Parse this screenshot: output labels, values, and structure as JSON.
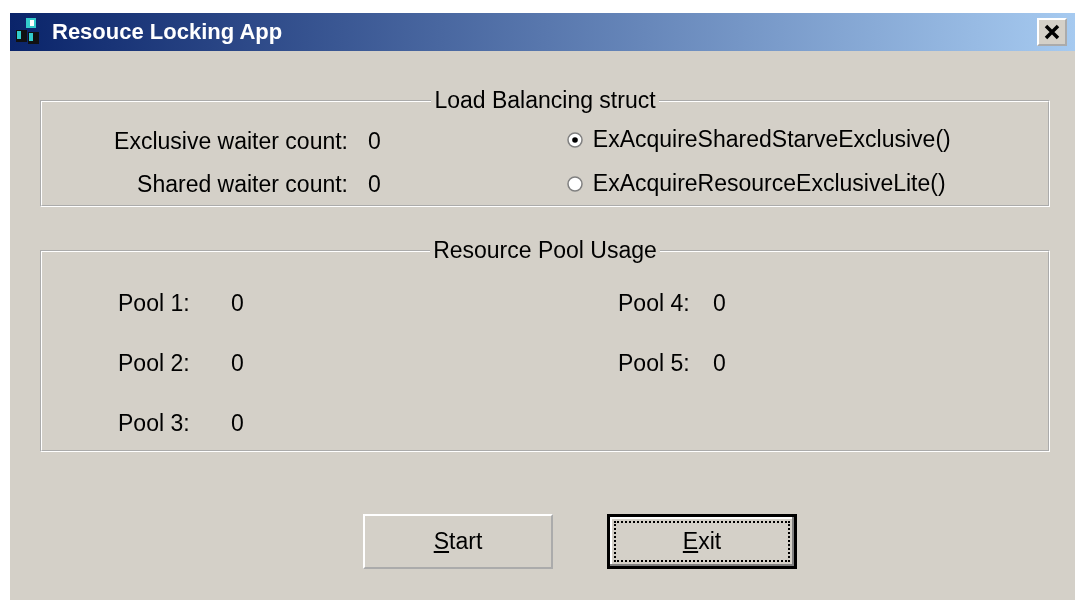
{
  "window": {
    "title": "Resouce Locking App"
  },
  "load_balancing": {
    "title": "Load Balancing struct",
    "counts": [
      {
        "label": "Exclusive waiter count:",
        "value": "0"
      },
      {
        "label": "Shared waiter count:",
        "value": "0"
      }
    ],
    "options": [
      {
        "label": "ExAcquireSharedStarveExclusive()",
        "selected": true
      },
      {
        "label": "ExAcquireResourceExclusiveLite()",
        "selected": false
      }
    ]
  },
  "resource_pool": {
    "title": "Resource Pool Usage",
    "pools": [
      {
        "label": "Pool 1:",
        "value": "0"
      },
      {
        "label": "Pool 2:",
        "value": "0"
      },
      {
        "label": "Pool 3:",
        "value": "0"
      },
      {
        "label": "Pool 4:",
        "value": "0"
      },
      {
        "label": "Pool 5:",
        "value": "0"
      }
    ]
  },
  "buttons": [
    {
      "label": "Start",
      "underline_first": true,
      "default": false
    },
    {
      "label": "Exit",
      "underline_first": true,
      "default": true
    }
  ]
}
